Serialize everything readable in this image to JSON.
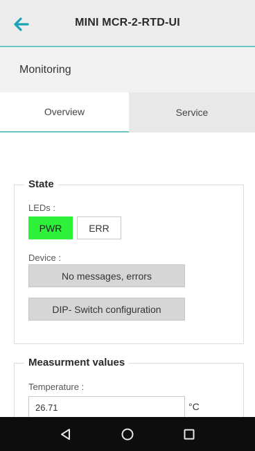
{
  "app_bar": {
    "title": "MINI MCR-2-RTD-UI",
    "back_icon": "back-arrow-icon",
    "accent": "#1aa3b5"
  },
  "section": {
    "title": "Monitoring"
  },
  "tabs": [
    {
      "label": "Overview",
      "active": true
    },
    {
      "label": "Service",
      "active": false
    }
  ],
  "state": {
    "legend": "State",
    "leds_label": "LEDs :",
    "leds": [
      {
        "label": "PWR",
        "on": true,
        "color": "#2ef23a"
      },
      {
        "label": "ERR",
        "on": false
      }
    ],
    "device_label": "Device :",
    "device_status": "No messages, errors",
    "dip_button": "DIP- Switch configuration"
  },
  "measurement": {
    "legend": "Measurment values",
    "temperature_label": "Temperature :",
    "temperature_value": "26.71",
    "temperature_unit": "°C"
  },
  "nav_bar": {
    "icons": [
      "back-triangle-icon",
      "home-circle-icon",
      "recents-square-icon"
    ]
  }
}
